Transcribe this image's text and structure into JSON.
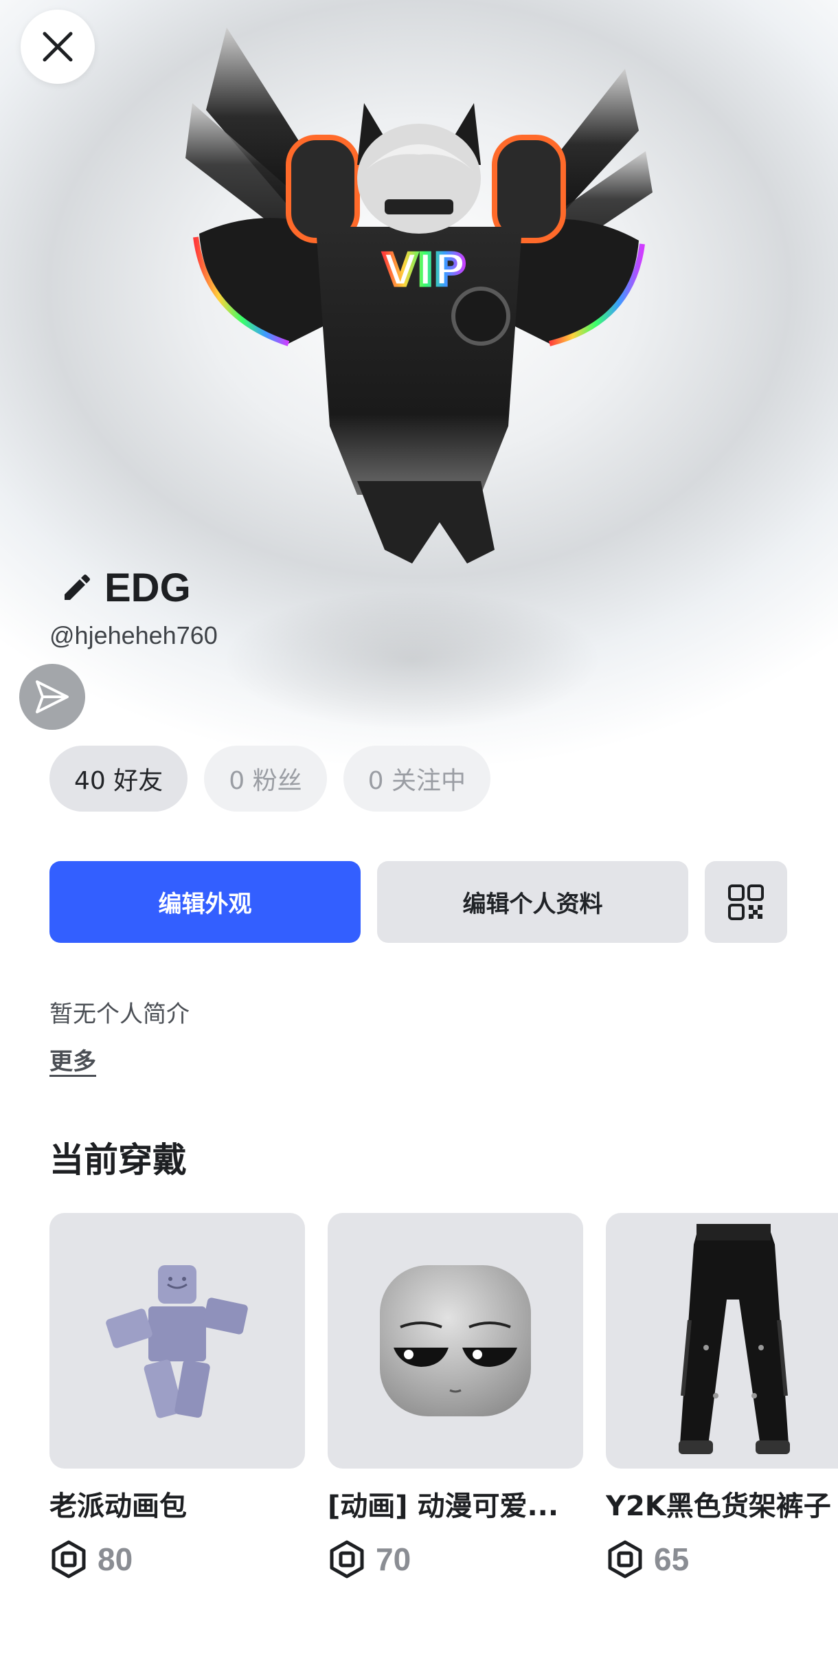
{
  "profile": {
    "display_name": "EDG",
    "username": "@hjeheheh760"
  },
  "avatar": {
    "shirt_text": "VIP"
  },
  "stats": {
    "friends": "40 好友",
    "followers": "0 粉丝",
    "following": "0 关注中"
  },
  "actions": {
    "edit_avatar": "编辑外观",
    "edit_profile": "编辑个人资料"
  },
  "bio": {
    "text": "暂无个人简介",
    "more": "更多"
  },
  "currently_wearing": {
    "title": "当前穿戴",
    "items": [
      {
        "name": "老派动画包",
        "price": "80"
      },
      {
        "name": "[动画] 动漫可爱...",
        "price": "70"
      },
      {
        "name": "Y2K黑色货架裤子",
        "price": "65"
      }
    ]
  },
  "icons": {
    "close": "close-icon",
    "edit": "pencil-icon",
    "share": "send-icon",
    "qr": "qr-code-icon",
    "currency": "robux-icon"
  },
  "colors": {
    "primary": "#335fff",
    "chip_bg": "#e3e4e8",
    "price_text": "#8a8d93"
  }
}
